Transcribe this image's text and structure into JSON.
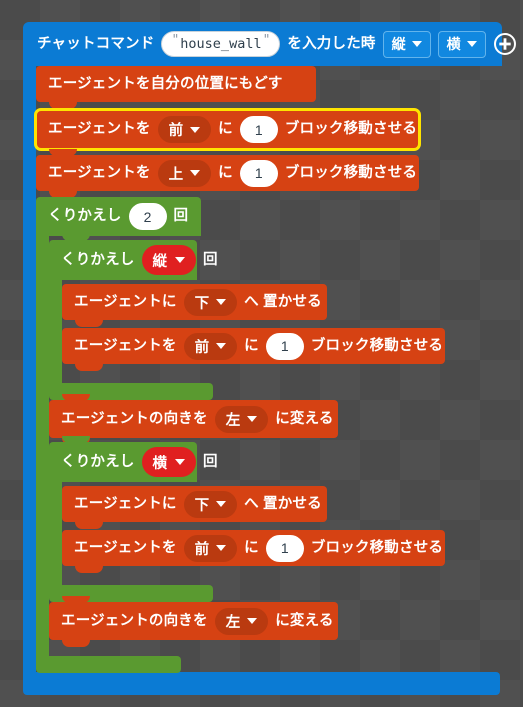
{
  "workspace": {
    "background_color": "#4b4b4b",
    "grid_color": "#505050"
  },
  "colors": {
    "event_blue": "#0b7bd4",
    "agent_red": "#d64213",
    "loop_green": "#5a9a30",
    "variable_red": "#e02020",
    "selection_yellow": "#ffe400"
  },
  "hat_block": {
    "name": "chat-command-event",
    "label_prefix": "チャットコマンド",
    "command_value": "house_wall",
    "quote": "\"",
    "label_suffix": "を入力した時",
    "params": [
      {
        "name": "param-tate",
        "value": "縦"
      },
      {
        "name": "param-yoko",
        "value": "横"
      }
    ],
    "add_param_icon": "plus-circle-icon"
  },
  "blocks": [
    {
      "id": "b1",
      "type": "statement",
      "color": "red",
      "selected": false,
      "parts": [
        {
          "kind": "label",
          "text": "エージェントを自分の位置にもどす"
        }
      ]
    },
    {
      "id": "b2",
      "type": "statement",
      "color": "red",
      "selected": true,
      "parts": [
        {
          "kind": "label",
          "text": "エージェントを"
        },
        {
          "kind": "dropdown",
          "text": "前"
        },
        {
          "kind": "label",
          "text": "に"
        },
        {
          "kind": "number",
          "text": "1"
        },
        {
          "kind": "label",
          "text": "ブロック移動させる"
        }
      ]
    },
    {
      "id": "b3",
      "type": "statement",
      "color": "red",
      "selected": false,
      "parts": [
        {
          "kind": "label",
          "text": "エージェントを"
        },
        {
          "kind": "dropdown",
          "text": "上"
        },
        {
          "kind": "label",
          "text": "に"
        },
        {
          "kind": "number",
          "text": "1"
        },
        {
          "kind": "label",
          "text": "ブロック移動させる"
        }
      ]
    },
    {
      "id": "loop_outer",
      "type": "loop",
      "color": "green",
      "parts": [
        {
          "kind": "label",
          "text": "くりかえし"
        },
        {
          "kind": "number",
          "text": "2"
        },
        {
          "kind": "label",
          "text": "回"
        }
      ]
    },
    {
      "id": "loop_tate",
      "type": "loop",
      "color": "green",
      "parts": [
        {
          "kind": "label",
          "text": "くりかえし"
        },
        {
          "kind": "variable",
          "text": "縦"
        },
        {
          "kind": "label",
          "text": "回"
        }
      ]
    },
    {
      "id": "b4",
      "type": "statement",
      "color": "red",
      "parts": [
        {
          "kind": "label",
          "text": "エージェントに"
        },
        {
          "kind": "dropdown",
          "text": "下"
        },
        {
          "kind": "label",
          "text": "へ 置かせる"
        }
      ]
    },
    {
      "id": "b5",
      "type": "statement",
      "color": "red",
      "parts": [
        {
          "kind": "label",
          "text": "エージェントを"
        },
        {
          "kind": "dropdown",
          "text": "前"
        },
        {
          "kind": "label",
          "text": "に"
        },
        {
          "kind": "number",
          "text": "1"
        },
        {
          "kind": "label",
          "text": "ブロック移動させる"
        }
      ]
    },
    {
      "id": "b6",
      "type": "statement",
      "color": "red",
      "parts": [
        {
          "kind": "label",
          "text": "エージェントの向きを"
        },
        {
          "kind": "dropdown",
          "text": "左"
        },
        {
          "kind": "label",
          "text": "に変える"
        }
      ]
    },
    {
      "id": "loop_yoko",
      "type": "loop",
      "color": "green",
      "parts": [
        {
          "kind": "label",
          "text": "くりかえし"
        },
        {
          "kind": "variable",
          "text": "横"
        },
        {
          "kind": "label",
          "text": "回"
        }
      ]
    },
    {
      "id": "b7",
      "type": "statement",
      "color": "red",
      "parts": [
        {
          "kind": "label",
          "text": "エージェントに"
        },
        {
          "kind": "dropdown",
          "text": "下"
        },
        {
          "kind": "label",
          "text": "へ 置かせる"
        }
      ]
    },
    {
      "id": "b8",
      "type": "statement",
      "color": "red",
      "parts": [
        {
          "kind": "label",
          "text": "エージェントを"
        },
        {
          "kind": "dropdown",
          "text": "前"
        },
        {
          "kind": "label",
          "text": "に"
        },
        {
          "kind": "number",
          "text": "1"
        },
        {
          "kind": "label",
          "text": "ブロック移動させる"
        }
      ]
    },
    {
      "id": "b9",
      "type": "statement",
      "color": "red",
      "parts": [
        {
          "kind": "label",
          "text": "エージェントの向きを"
        },
        {
          "kind": "dropdown",
          "text": "左"
        },
        {
          "kind": "label",
          "text": "に変える"
        }
      ]
    }
  ]
}
